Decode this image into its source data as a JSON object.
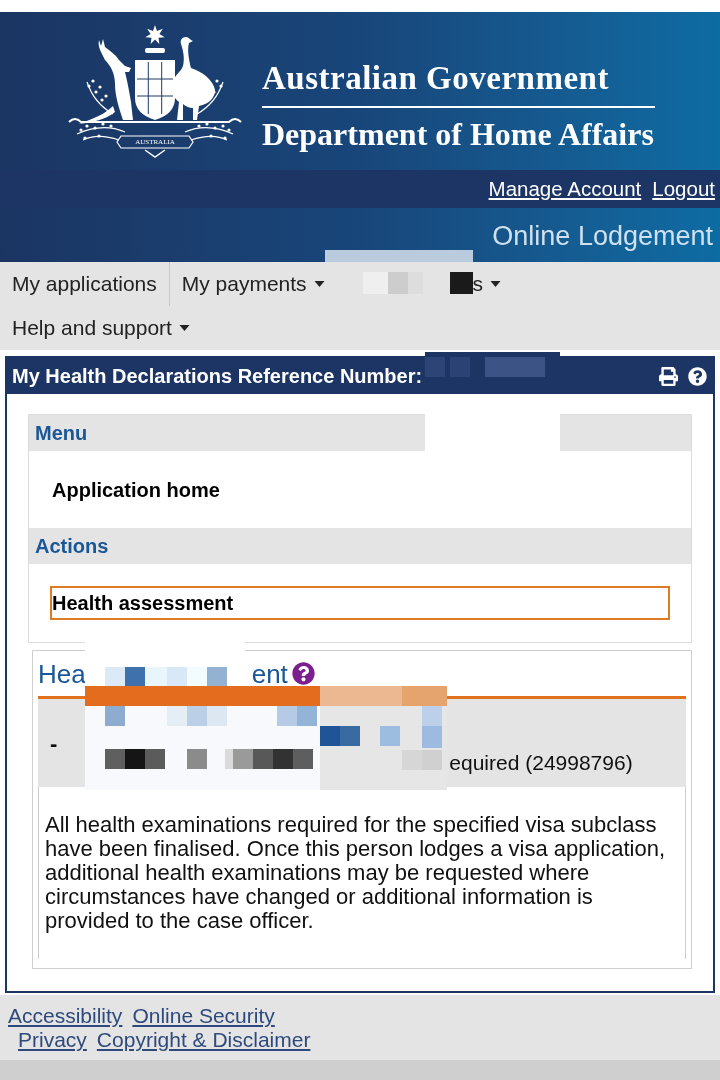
{
  "header": {
    "crest_motto": "AUSTRALIA",
    "agency_line_1": "Australian Government",
    "agency_line_2": "Department of Home Affairs",
    "account_links": [
      {
        "label": "Manage Account"
      },
      {
        "label": "Logout"
      }
    ],
    "portal_title": "Online Lodgement"
  },
  "nav": {
    "rows": [
      [
        {
          "label": "My applications",
          "dropdown": false,
          "redacted": false
        },
        {
          "label": "My payments",
          "dropdown": true,
          "redacted": false
        },
        {
          "label": "s",
          "dropdown": true,
          "redacted": true
        }
      ],
      [
        {
          "label": "Help and support",
          "dropdown": true,
          "redacted": false
        }
      ]
    ]
  },
  "panel": {
    "title": "My Health Declarations Reference Number:",
    "reference_redacted": true,
    "menu": {
      "heading": "Menu",
      "items": [
        {
          "label": "Application home",
          "focused": false
        }
      ]
    },
    "actions": {
      "heading": "Actions",
      "items": [
        {
          "label": "Health assessment",
          "focused": true
        }
      ]
    },
    "assessment": {
      "title_start": "Hea",
      "title_end": "ent",
      "redacted": true,
      "row_marker": "-",
      "row_text": "equired (24998796)",
      "message": "All health examinations required for the specified visa subclass have been finalised. Once this person lodges a visa application, additional health examinations may be requested where circumstances have changed or additional information is provided to the case officer."
    }
  },
  "footer": {
    "link_rows": [
      [
        {
          "label": "Accessibility"
        },
        {
          "label": "Online Security"
        }
      ],
      [
        {
          "label": "Privacy"
        },
        {
          "label": "Copyright & Disclaimer"
        }
      ]
    ]
  }
}
